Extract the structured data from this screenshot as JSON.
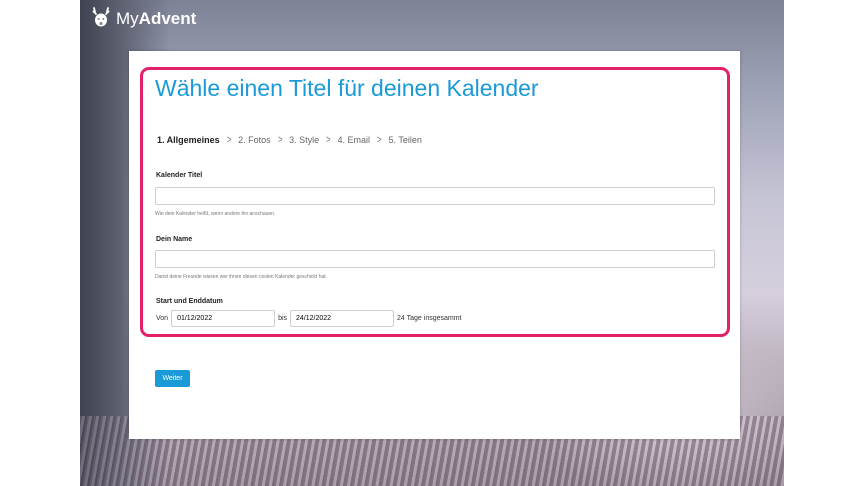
{
  "brand": {
    "logo_icon": "reindeer-icon",
    "name_light": "My",
    "name_bold": "Advent"
  },
  "colors": {
    "accent": "#1a9ad7",
    "highlight": "#e5206b"
  },
  "page": {
    "title": "Wähle einen Titel für deinen Kalender"
  },
  "steps": [
    {
      "label": "1. Allgemeines",
      "active": true
    },
    {
      "label": "2. Fotos"
    },
    {
      "label": "3. Style"
    },
    {
      "label": "4. Email"
    },
    {
      "label": "5. Teilen"
    }
  ],
  "form": {
    "title_field": {
      "label": "Kalender Titel",
      "value": "",
      "help": "Wie dein Kalender heißt, wenn andere ihn anschauen."
    },
    "name_field": {
      "label": "Dein Name",
      "value": "",
      "help": "Damit deine Freunde wissen wer ihnen diesen coolen Kalender geschickt hat."
    },
    "dates": {
      "label": "Start und Enddatum",
      "from_label": "Von",
      "from_value": "01/12/2022",
      "to_label": "bis",
      "to_value": "24/12/2022",
      "total": "24 Tage insgesammt"
    }
  },
  "next_button": "Weiter"
}
